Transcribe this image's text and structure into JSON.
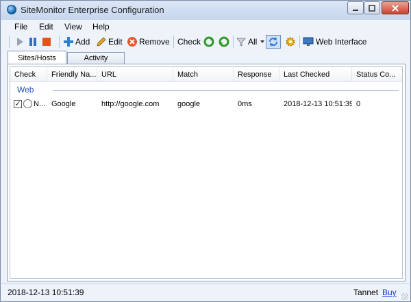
{
  "window": {
    "title": "SiteMonitor Enterprise Configuration"
  },
  "menu": {
    "items": [
      "File",
      "Edit",
      "View",
      "Help"
    ]
  },
  "toolbar": {
    "add_label": "Add",
    "edit_label": "Edit",
    "remove_label": "Remove",
    "check_label": "Check",
    "filter_label": "All",
    "web_interface_label": "Web Interface"
  },
  "tabs": [
    {
      "label": "Sites/Hosts",
      "active": true
    },
    {
      "label": "Activity",
      "active": false
    }
  ],
  "table": {
    "columns": [
      "Check",
      "Friendly Na...",
      "URL",
      "Match",
      "Response",
      "Last Checked",
      "Status Co..."
    ],
    "group": "Web",
    "rows": [
      {
        "checked": true,
        "check_text": "N...",
        "friendly_name": "Google",
        "url": "http://google.com",
        "match": "google",
        "response": "0ms",
        "last_checked": "2018-12-13 10:51:39",
        "status_code": "0"
      }
    ]
  },
  "status": {
    "timestamp": "2018-12-13 10:51:39",
    "vendor": "Tannet",
    "buy_link": "Buy"
  },
  "colors": {
    "group_text": "#1e4fb0",
    "link": "#0b40d6"
  }
}
